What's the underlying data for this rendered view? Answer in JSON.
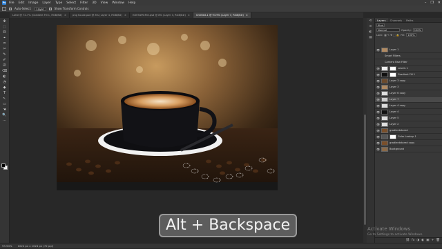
{
  "app": {
    "logo": "Ps"
  },
  "menu": [
    "File",
    "Edit",
    "Image",
    "Layer",
    "Type",
    "Select",
    "Filter",
    "3D",
    "View",
    "Window",
    "Help"
  ],
  "window_controls": [
    "–",
    "❐",
    "✕"
  ],
  "options_bar": {
    "auto_select_label": "Auto-Select:",
    "auto_select_value": "Layer",
    "transform_label": "Show Transform Controls"
  },
  "tabs": [
    {
      "label": "Latte @ 72.7% (Gradient Fill 1, RGB/8#)",
      "active": false
    },
    {
      "label": "png house.psd @ 8% (Layer 4, RGB/8#)",
      "active": false
    },
    {
      "label": "EditTrafficFile.psd @ 8% (Layer 3, RGB/8#)",
      "active": false
    },
    {
      "label": "Untitled-1 @ 93.9% (Layer 7, RGB/8#)",
      "active": true
    }
  ],
  "tools": [
    "✥",
    "⬚",
    "ʘ",
    "⌖",
    "⌗",
    "✂",
    "✎",
    "✐",
    "⎚",
    "⌫",
    "◐",
    "◔",
    "◆",
    "T",
    "↖",
    "▭",
    "☚",
    "🔍",
    "⋯"
  ],
  "status": {
    "zoom": "93.94%",
    "doc": "1024 px x 1024 px (72 ppi)"
  },
  "panel": {
    "tabs": [
      "Layers",
      "Channels",
      "Paths"
    ],
    "kind": "Kind",
    "blend_mode": "Normal",
    "opacity_label": "Opacity:",
    "opacity_value": "100%",
    "lock_label": "Lock:",
    "fill_label": "Fill:",
    "fill_value": "100%"
  },
  "layers": [
    {
      "name": "Layer 1",
      "type": "normal",
      "active": false
    },
    {
      "name": "Smart Filters",
      "type": "sub",
      "active": false
    },
    {
      "name": "Camera Raw Filter",
      "type": "sub",
      "active": false
    },
    {
      "name": "Levels 1",
      "type": "adj",
      "active": false
    },
    {
      "name": "Gradient Fill 1",
      "type": "adj",
      "active": false
    },
    {
      "name": "Layer 3 copy",
      "type": "normal",
      "active": false
    },
    {
      "name": "Layer 3",
      "type": "normal",
      "active": false
    },
    {
      "name": "Layer 6 copy",
      "type": "normal",
      "active": false
    },
    {
      "name": "Layer 7",
      "type": "normal",
      "active": true
    },
    {
      "name": "Layer 4 copy",
      "type": "normal",
      "active": false
    },
    {
      "name": "Layer 4",
      "type": "normal",
      "active": false
    },
    {
      "name": "Layer 5",
      "type": "normal",
      "active": false
    },
    {
      "name": "Layer 2",
      "type": "normal",
      "active": false
    },
    {
      "name": "gradientstored",
      "type": "normal",
      "active": false
    },
    {
      "name": "Color Lookup 1",
      "type": "adj",
      "active": false
    },
    {
      "name": "gradientstored copy",
      "type": "normal",
      "active": false
    },
    {
      "name": "Background",
      "type": "bg",
      "active": false
    }
  ],
  "panel_footer_icons": [
    "⛓",
    "fx",
    "◑",
    "◐",
    "▣",
    "+",
    "🗑"
  ],
  "shortcut_overlay": "Alt + Backspace",
  "watermark": {
    "title": "Activate Windows",
    "subtitle": "Go to Settings to activate Windows."
  },
  "colors": {
    "accent": "#2b7fd6",
    "background": "#282828",
    "panel": "#383838"
  }
}
